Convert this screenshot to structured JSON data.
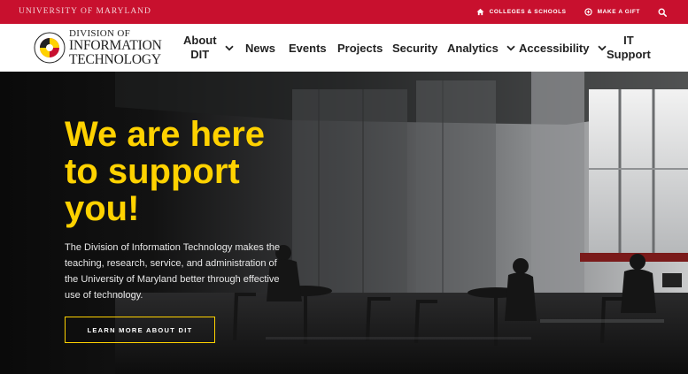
{
  "utility": {
    "umd_label": "UNIVERSITY OF MARYLAND",
    "links": [
      {
        "label": "COLLEGES & SCHOOLS",
        "icon": "home-icon"
      },
      {
        "label": "MAKE A GIFT",
        "icon": "gift-icon"
      }
    ],
    "search_icon": "search-icon"
  },
  "logo": {
    "line1": "DIVISION OF",
    "line2": "INFORMATION",
    "line3": "TECHNOLOGY",
    "seal_text": "UNIVERSITY OF MARYLAND"
  },
  "nav": {
    "items": [
      {
        "line1": "About",
        "line2": "DIT",
        "has_dropdown": true
      },
      {
        "label": "News"
      },
      {
        "label": "Events"
      },
      {
        "label": "Projects"
      },
      {
        "label": "Security"
      },
      {
        "label": "Analytics",
        "has_dropdown": true
      },
      {
        "label": "Accessibility",
        "has_dropdown": true
      },
      {
        "line1": "IT",
        "line2": "Support"
      }
    ]
  },
  "hero": {
    "title_line1": "We are here",
    "title_line2": "to support",
    "title_line3": "you!",
    "description": "The Division of Information Technology makes the teaching, research, service, and administration of the University of Maryland better through effective use of technology.",
    "cta_label": "LEARN MORE ABOUT DIT"
  },
  "colors": {
    "brand_red": "#c8102e",
    "accent_gold": "#ffd200",
    "nav_text": "#222222"
  }
}
